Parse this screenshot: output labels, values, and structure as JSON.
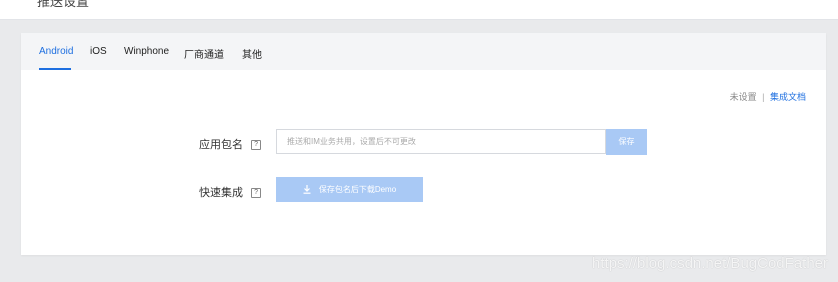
{
  "header": {
    "title": "推送设置"
  },
  "tabs": [
    {
      "label": "Android",
      "active": true
    },
    {
      "label": "iOS",
      "active": false
    },
    {
      "label": "Winphone",
      "active": false
    },
    {
      "label": "厂商通道",
      "active": false
    },
    {
      "label": "其他",
      "active": false
    }
  ],
  "status_links": {
    "status": "未设置",
    "separator": "|",
    "doc_link": "集成文档"
  },
  "form": {
    "package_label": "应用包名",
    "package_placeholder": "推送和IM业务共用，设置后不可更改",
    "save_button": "保存",
    "quick_label": "快速集成",
    "download_button": "保存包名后下载Demo",
    "help_glyph": "?"
  },
  "watermark": "https://blog.csdn.net/BugCodFather",
  "colors": {
    "accent": "#1e6fe0",
    "button_disabled": "#a9c9f5",
    "page_bg": "#e9eaec",
    "tabs_bg": "#f4f5f7"
  },
  "icons": {
    "help": "question-icon",
    "download": "download-icon"
  }
}
